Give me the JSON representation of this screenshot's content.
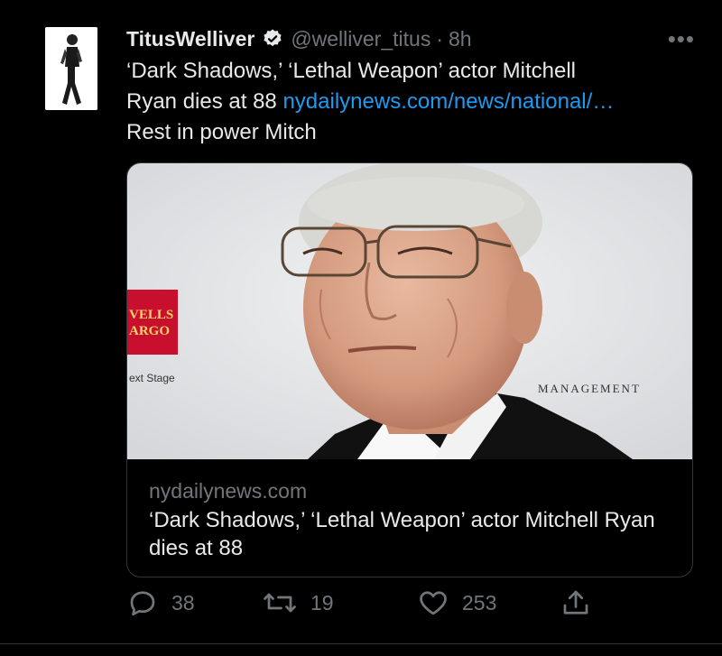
{
  "tweet": {
    "display_name": "TitusWelliver",
    "handle": "@welliver_titus",
    "separator": "·",
    "time": "8h",
    "more": "•••",
    "text_line1": "‘Dark Shadows,’ ‘Lethal Weapon’ actor Mitchell",
    "text_line2_prefix": "Ryan dies at 88",
    "text_link": "nydailynews.com/news/national/…",
    "text_line3": "Rest in power Mitch"
  },
  "card": {
    "domain": "nydailynews.com",
    "title": "‘Dark Shadows,’ ‘Lethal Weapon’ actor Mitchell Ryan dies at 88",
    "image_backdrop_text": {
      "sign_line1": "VELLS",
      "sign_line2": "ARGO",
      "stage": "ext Stage",
      "management": "MANAGEMENT"
    }
  },
  "actions": {
    "replies": "38",
    "retweets": "19",
    "likes": "253"
  },
  "colors": {
    "background": "#000000",
    "text": "#e7e9ea",
    "muted": "#71767b",
    "link": "#1d9bf0",
    "border": "#333639"
  }
}
